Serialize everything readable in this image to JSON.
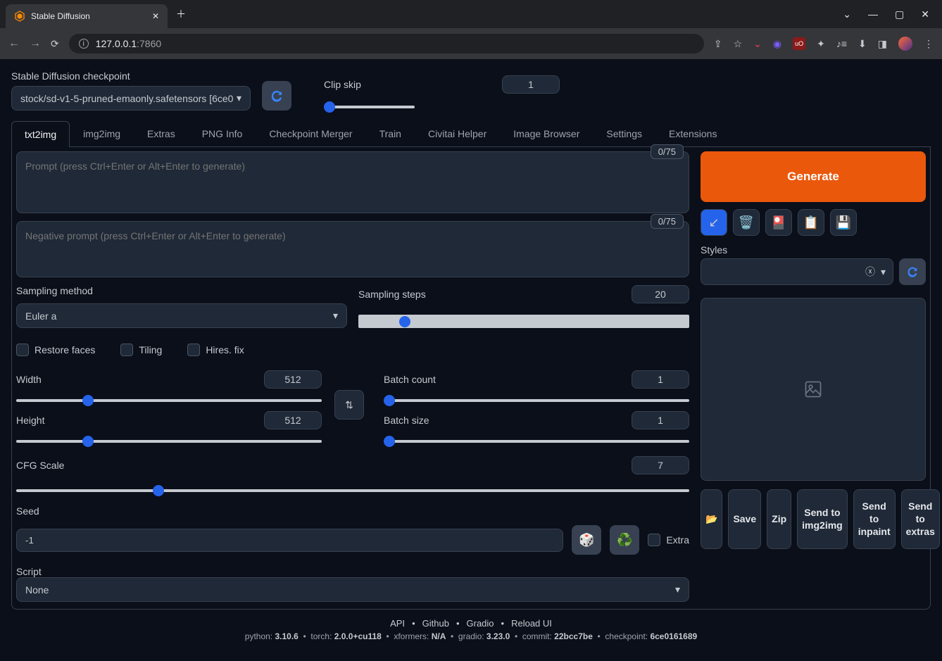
{
  "browser": {
    "tab_title": "Stable Diffusion",
    "url_host": "127.0.0.1",
    "url_port": ":7860"
  },
  "checkpoint": {
    "label": "Stable Diffusion checkpoint",
    "value": "stock/sd-v1-5-pruned-emaonly.safetensors [6ce0"
  },
  "clip": {
    "label": "Clip skip",
    "value": "1"
  },
  "tabs": [
    "txt2img",
    "img2img",
    "Extras",
    "PNG Info",
    "Checkpoint Merger",
    "Train",
    "Civitai Helper",
    "Image Browser",
    "Settings",
    "Extensions"
  ],
  "active_tab": "txt2img",
  "prompt": {
    "placeholder": "Prompt (press Ctrl+Enter or Alt+Enter to generate)",
    "token_count": "0/75"
  },
  "neg_prompt": {
    "placeholder": "Negative prompt (press Ctrl+Enter or Alt+Enter to generate)",
    "token_count": "0/75"
  },
  "generate": "Generate",
  "styles_label": "Styles",
  "sampling": {
    "method_label": "Sampling method",
    "method_value": "Euler a",
    "steps_label": "Sampling steps",
    "steps_value": "20"
  },
  "checks": {
    "restore": "Restore faces",
    "tiling": "Tiling",
    "hires": "Hires. fix"
  },
  "dims": {
    "width_label": "Width",
    "width_value": "512",
    "height_label": "Height",
    "height_value": "512",
    "batch_count_label": "Batch count",
    "batch_count_value": "1",
    "batch_size_label": "Batch size",
    "batch_size_value": "1"
  },
  "cfg": {
    "label": "CFG Scale",
    "value": "7"
  },
  "seed": {
    "label": "Seed",
    "value": "-1",
    "extra_label": "Extra"
  },
  "script": {
    "label": "Script",
    "value": "None"
  },
  "out_btns": {
    "folder": "📂",
    "save": "Save",
    "zip": "Zip",
    "img2img_1": "Send to",
    "img2img_2": "img2img",
    "inpaint_1": "Send to",
    "inpaint_2": "inpaint",
    "extras_1": "Send to",
    "extras_2": "extras"
  },
  "footer": {
    "links": [
      "API",
      "Github",
      "Gradio",
      "Reload UI"
    ],
    "python": "3.10.6",
    "torch": "2.0.0+cu118",
    "xformers": "N/A",
    "gradio": "3.23.0",
    "commit": "22bcc7be",
    "checkpoint": "6ce0161689"
  }
}
